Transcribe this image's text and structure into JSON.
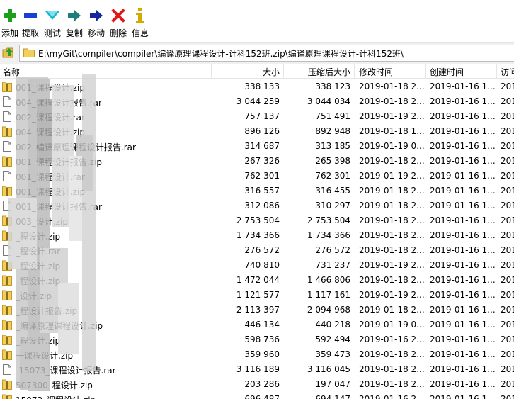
{
  "toolbar": {
    "buttons": [
      {
        "label": "添加",
        "icon": "plus-icon",
        "color": "#1aa01a"
      },
      {
        "label": "提取",
        "icon": "minus-icon",
        "color": "#1a3fd6"
      },
      {
        "label": "测试",
        "icon": "check-icon",
        "color": "#17b5c9"
      },
      {
        "label": "复制",
        "icon": "copy-arrow-icon",
        "color": "#1a7f7a"
      },
      {
        "label": "移动",
        "icon": "move-arrow-icon",
        "color": "#14289e"
      },
      {
        "label": "删除",
        "icon": "delete-x-icon",
        "color": "#e01818"
      },
      {
        "label": "信息",
        "icon": "info-icon",
        "color": "#d4a900"
      }
    ]
  },
  "address": {
    "path": "E:\\myGit\\compiler\\compiler\\编译原理课程设计-计科152班.zip\\编译原理课程设计-计科152班\\"
  },
  "columns": {
    "name": "名称",
    "size": "大小",
    "packed": "压缩后大小",
    "modified": "修改时间",
    "created": "创建时间",
    "accessed": "访问"
  },
  "files": [
    {
      "name": "001_课程设计.zip",
      "size": "338 133",
      "packed": "338 123",
      "modified": "2019-01-18 2...",
      "created": "2019-01-16 1...",
      "accessed": "201",
      "type": "zip"
    },
    {
      "name": "004_课程设计报告.rar",
      "size": "3 044 259",
      "packed": "3 044 034",
      "modified": "2019-01-18 2...",
      "created": "2019-01-16 1...",
      "accessed": "201",
      "type": "rar"
    },
    {
      "name": "002_课程设计.rar",
      "size": "757 137",
      "packed": "751 491",
      "modified": "2019-01-19 2...",
      "created": "2019-01-16 1...",
      "accessed": "201",
      "type": "rar"
    },
    {
      "name": "004_课程设计.zip",
      "size": "896 126",
      "packed": "892 948",
      "modified": "2019-01-18 1...",
      "created": "2019-01-16 1...",
      "accessed": "201",
      "type": "zip"
    },
    {
      "name": "002_编译原理课程设计报告.rar",
      "size": "314 687",
      "packed": "313 185",
      "modified": "2019-01-19 0...",
      "created": "2019-01-16 1...",
      "accessed": "201",
      "type": "rar"
    },
    {
      "name": "001_课程设计报告.zip",
      "size": "267 326",
      "packed": "265 398",
      "modified": "2019-01-18 2...",
      "created": "2019-01-16 1...",
      "accessed": "201",
      "type": "zip"
    },
    {
      "name": "001_课程设计.rar",
      "size": "762 301",
      "packed": "762 301",
      "modified": "2019-01-19 2...",
      "created": "2019-01-16 1...",
      "accessed": "201",
      "type": "rar"
    },
    {
      "name": "001_课程设计.zip",
      "size": "316 557",
      "packed": "316 455",
      "modified": "2019-01-18 2...",
      "created": "2019-01-16 1...",
      "accessed": "201",
      "type": "zip"
    },
    {
      "name": "001_课程设计报告.rar",
      "size": "312 086",
      "packed": "310 297",
      "modified": "2019-01-18 2...",
      "created": "2019-01-16 1...",
      "accessed": "201",
      "type": "rar"
    },
    {
      "name": "003_设计.zip",
      "size": "2 753 504",
      "packed": "2 753 504",
      "modified": "2019-01-18 2...",
      "created": "2019-01-16 1...",
      "accessed": "201",
      "type": "zip"
    },
    {
      "name": "_程设计.zip",
      "size": "1 734 366",
      "packed": "1 734 366",
      "modified": "2019-01-18 2...",
      "created": "2019-01-16 1...",
      "accessed": "201",
      "type": "zip"
    },
    {
      "name": "_程设计.rar",
      "size": "276 572",
      "packed": "276 572",
      "modified": "2019-01-18 2...",
      "created": "2019-01-16 1...",
      "accessed": "201",
      "type": "rar"
    },
    {
      "name": "_程设计.zip",
      "size": "740 810",
      "packed": "731 237",
      "modified": "2019-01-19 2...",
      "created": "2019-01-16 1...",
      "accessed": "201",
      "type": "zip"
    },
    {
      "name": "_程设计.zip",
      "size": "1 472 044",
      "packed": "1 466 806",
      "modified": "2019-01-18 2...",
      "created": "2019-01-16 1...",
      "accessed": "201",
      "type": "zip"
    },
    {
      "name": "_设计.zip",
      "size": "1 121 577",
      "packed": "1 117 161",
      "modified": "2019-01-19 2...",
      "created": "2019-01-16 1...",
      "accessed": "201",
      "type": "zip"
    },
    {
      "name": "_程设计报告.zip",
      "size": "2 113 397",
      "packed": "2 094 968",
      "modified": "2019-01-18 2...",
      "created": "2019-01-16 1...",
      "accessed": "201",
      "type": "zip"
    },
    {
      "name": "_编译原理课程设计.zip",
      "size": "446 134",
      "packed": "440 218",
      "modified": "2019-01-19 0...",
      "created": "2019-01-16 1...",
      "accessed": "201",
      "type": "zip"
    },
    {
      "name": "_程设计.zip",
      "size": "598 736",
      "packed": "592 494",
      "modified": "2019-01-16 2...",
      "created": "2019-01-16 1...",
      "accessed": "201",
      "type": "zip"
    },
    {
      "name": "一课程设计.zip",
      "size": "359 960",
      "packed": "359 473",
      "modified": "2019-01-18 2...",
      "created": "2019-01-16 1...",
      "accessed": "201",
      "type": "zip"
    },
    {
      "name": "-15073_课程设计报告.rar",
      "size": "3 116 189",
      "packed": "3 116 045",
      "modified": "2019-01-18 2...",
      "created": "2019-01-16 1...",
      "accessed": "201",
      "type": "rar"
    },
    {
      "name": "507300_程设计.zip",
      "size": "203 286",
      "packed": "197 047",
      "modified": "2019-01-18 2...",
      "created": "2019-01-16 1...",
      "accessed": "201",
      "type": "zip"
    },
    {
      "name": "15073_课程设计.zip",
      "size": "696 487",
      "packed": "694 147",
      "modified": "2019-01-16 2...",
      "created": "2019-01-16 1...",
      "accessed": "201",
      "type": "zip"
    }
  ]
}
